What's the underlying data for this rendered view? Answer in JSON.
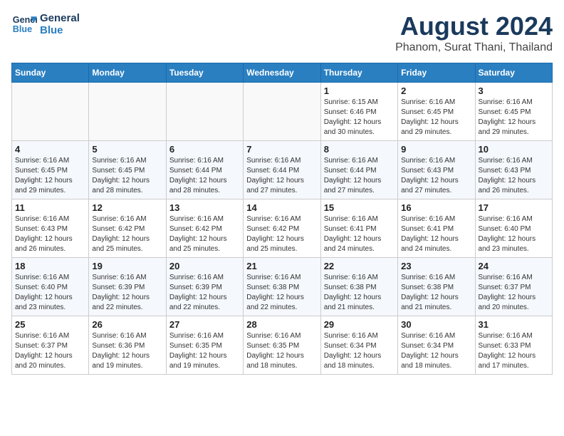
{
  "logo": {
    "line1": "General",
    "line2": "Blue"
  },
  "title": "August 2024",
  "subtitle": "Phanom, Surat Thani, Thailand",
  "days_of_week": [
    "Sunday",
    "Monday",
    "Tuesday",
    "Wednesday",
    "Thursday",
    "Friday",
    "Saturday"
  ],
  "weeks": [
    [
      {
        "day": "",
        "info": ""
      },
      {
        "day": "",
        "info": ""
      },
      {
        "day": "",
        "info": ""
      },
      {
        "day": "",
        "info": ""
      },
      {
        "day": "1",
        "info": "Sunrise: 6:15 AM\nSunset: 6:46 PM\nDaylight: 12 hours\nand 30 minutes."
      },
      {
        "day": "2",
        "info": "Sunrise: 6:16 AM\nSunset: 6:45 PM\nDaylight: 12 hours\nand 29 minutes."
      },
      {
        "day": "3",
        "info": "Sunrise: 6:16 AM\nSunset: 6:45 PM\nDaylight: 12 hours\nand 29 minutes."
      }
    ],
    [
      {
        "day": "4",
        "info": "Sunrise: 6:16 AM\nSunset: 6:45 PM\nDaylight: 12 hours\nand 29 minutes."
      },
      {
        "day": "5",
        "info": "Sunrise: 6:16 AM\nSunset: 6:45 PM\nDaylight: 12 hours\nand 28 minutes."
      },
      {
        "day": "6",
        "info": "Sunrise: 6:16 AM\nSunset: 6:44 PM\nDaylight: 12 hours\nand 28 minutes."
      },
      {
        "day": "7",
        "info": "Sunrise: 6:16 AM\nSunset: 6:44 PM\nDaylight: 12 hours\nand 27 minutes."
      },
      {
        "day": "8",
        "info": "Sunrise: 6:16 AM\nSunset: 6:44 PM\nDaylight: 12 hours\nand 27 minutes."
      },
      {
        "day": "9",
        "info": "Sunrise: 6:16 AM\nSunset: 6:43 PM\nDaylight: 12 hours\nand 27 minutes."
      },
      {
        "day": "10",
        "info": "Sunrise: 6:16 AM\nSunset: 6:43 PM\nDaylight: 12 hours\nand 26 minutes."
      }
    ],
    [
      {
        "day": "11",
        "info": "Sunrise: 6:16 AM\nSunset: 6:43 PM\nDaylight: 12 hours\nand 26 minutes."
      },
      {
        "day": "12",
        "info": "Sunrise: 6:16 AM\nSunset: 6:42 PM\nDaylight: 12 hours\nand 25 minutes."
      },
      {
        "day": "13",
        "info": "Sunrise: 6:16 AM\nSunset: 6:42 PM\nDaylight: 12 hours\nand 25 minutes."
      },
      {
        "day": "14",
        "info": "Sunrise: 6:16 AM\nSunset: 6:42 PM\nDaylight: 12 hours\nand 25 minutes."
      },
      {
        "day": "15",
        "info": "Sunrise: 6:16 AM\nSunset: 6:41 PM\nDaylight: 12 hours\nand 24 minutes."
      },
      {
        "day": "16",
        "info": "Sunrise: 6:16 AM\nSunset: 6:41 PM\nDaylight: 12 hours\nand 24 minutes."
      },
      {
        "day": "17",
        "info": "Sunrise: 6:16 AM\nSunset: 6:40 PM\nDaylight: 12 hours\nand 23 minutes."
      }
    ],
    [
      {
        "day": "18",
        "info": "Sunrise: 6:16 AM\nSunset: 6:40 PM\nDaylight: 12 hours\nand 23 minutes."
      },
      {
        "day": "19",
        "info": "Sunrise: 6:16 AM\nSunset: 6:39 PM\nDaylight: 12 hours\nand 22 minutes."
      },
      {
        "day": "20",
        "info": "Sunrise: 6:16 AM\nSunset: 6:39 PM\nDaylight: 12 hours\nand 22 minutes."
      },
      {
        "day": "21",
        "info": "Sunrise: 6:16 AM\nSunset: 6:38 PM\nDaylight: 12 hours\nand 22 minutes."
      },
      {
        "day": "22",
        "info": "Sunrise: 6:16 AM\nSunset: 6:38 PM\nDaylight: 12 hours\nand 21 minutes."
      },
      {
        "day": "23",
        "info": "Sunrise: 6:16 AM\nSunset: 6:38 PM\nDaylight: 12 hours\nand 21 minutes."
      },
      {
        "day": "24",
        "info": "Sunrise: 6:16 AM\nSunset: 6:37 PM\nDaylight: 12 hours\nand 20 minutes."
      }
    ],
    [
      {
        "day": "25",
        "info": "Sunrise: 6:16 AM\nSunset: 6:37 PM\nDaylight: 12 hours\nand 20 minutes."
      },
      {
        "day": "26",
        "info": "Sunrise: 6:16 AM\nSunset: 6:36 PM\nDaylight: 12 hours\nand 19 minutes."
      },
      {
        "day": "27",
        "info": "Sunrise: 6:16 AM\nSunset: 6:35 PM\nDaylight: 12 hours\nand 19 minutes."
      },
      {
        "day": "28",
        "info": "Sunrise: 6:16 AM\nSunset: 6:35 PM\nDaylight: 12 hours\nand 18 minutes."
      },
      {
        "day": "29",
        "info": "Sunrise: 6:16 AM\nSunset: 6:34 PM\nDaylight: 12 hours\nand 18 minutes."
      },
      {
        "day": "30",
        "info": "Sunrise: 6:16 AM\nSunset: 6:34 PM\nDaylight: 12 hours\nand 18 minutes."
      },
      {
        "day": "31",
        "info": "Sunrise: 6:16 AM\nSunset: 6:33 PM\nDaylight: 12 hours\nand 17 minutes."
      }
    ]
  ]
}
